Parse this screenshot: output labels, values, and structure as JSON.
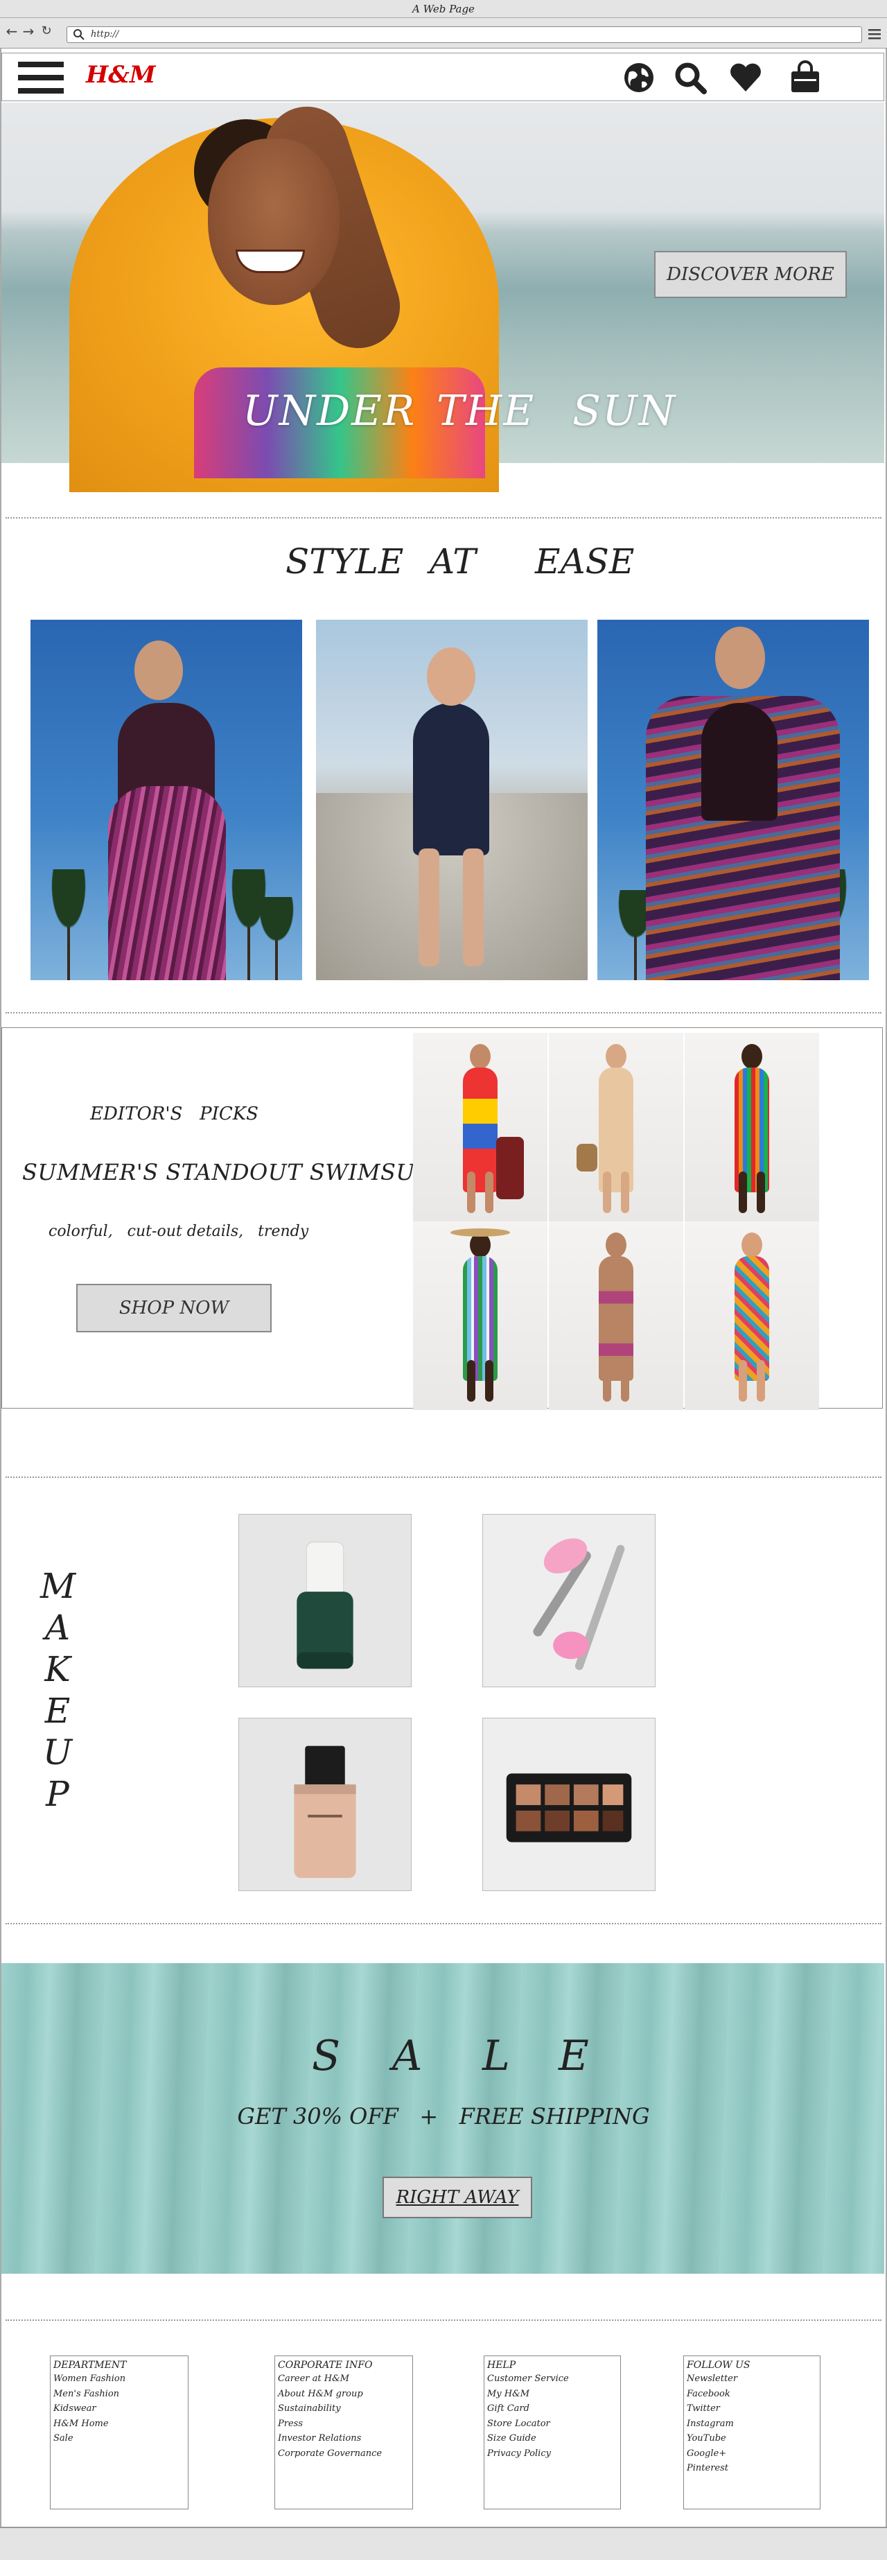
{
  "browser": {
    "window_title": "A Web Page",
    "url": "http://"
  },
  "header": {
    "logo": "H&M",
    "icons": [
      "menu-icon",
      "globe-icon",
      "search-icon",
      "heart-icon",
      "bag-icon"
    ]
  },
  "hero": {
    "title_words": [
      "UNDER",
      "THE",
      "SUN"
    ],
    "button_label": "DISCOVER MORE"
  },
  "style_section": {
    "title_words": [
      "STYLE",
      "AT",
      "EASE"
    ]
  },
  "editor_picks": {
    "label": "EDITOR'S   PICKS",
    "headline": "SUMMER'S STANDOUT SWIMSUITS",
    "tags": "colorful,   cut-out details,   trendy",
    "button_label": "SHOP NOW"
  },
  "makeup": {
    "title_letters": [
      "M",
      "A",
      "K",
      "E",
      "U",
      "P"
    ]
  },
  "sale": {
    "title_letters": [
      "S",
      "A",
      "L",
      "E"
    ],
    "subtitle": "GET 30% OFF   +   FREE SHIPPING",
    "button_label": "RIGHT AWAY"
  },
  "footer": {
    "columns": [
      {
        "heading": "DEPARTMENT",
        "links": [
          "Women Fashion",
          "Men's Fashion",
          "Kidswear",
          "H&M Home",
          "Sale"
        ]
      },
      {
        "heading": "CORPORATE INFO",
        "links": [
          "Career at H&M",
          "About H&M group",
          "Sustainability",
          "Press",
          "Investor Relations",
          "Corporate Governance"
        ]
      },
      {
        "heading": "HELP",
        "links": [
          "Customer Service",
          "My H&M",
          "Gift Card",
          "Store Locator",
          "Size Guide",
          "Privacy Policy"
        ]
      },
      {
        "heading": "FOLLOW US",
        "links": [
          "Newsletter",
          "Facebook",
          "Twitter",
          "Instagram",
          "YouTube",
          "Google+",
          "Pinterest"
        ]
      }
    ]
  },
  "colors": {
    "brand_red": "#d40000",
    "sale_teal": "#98cbc6",
    "button_gray": "#dcdcdc"
  }
}
